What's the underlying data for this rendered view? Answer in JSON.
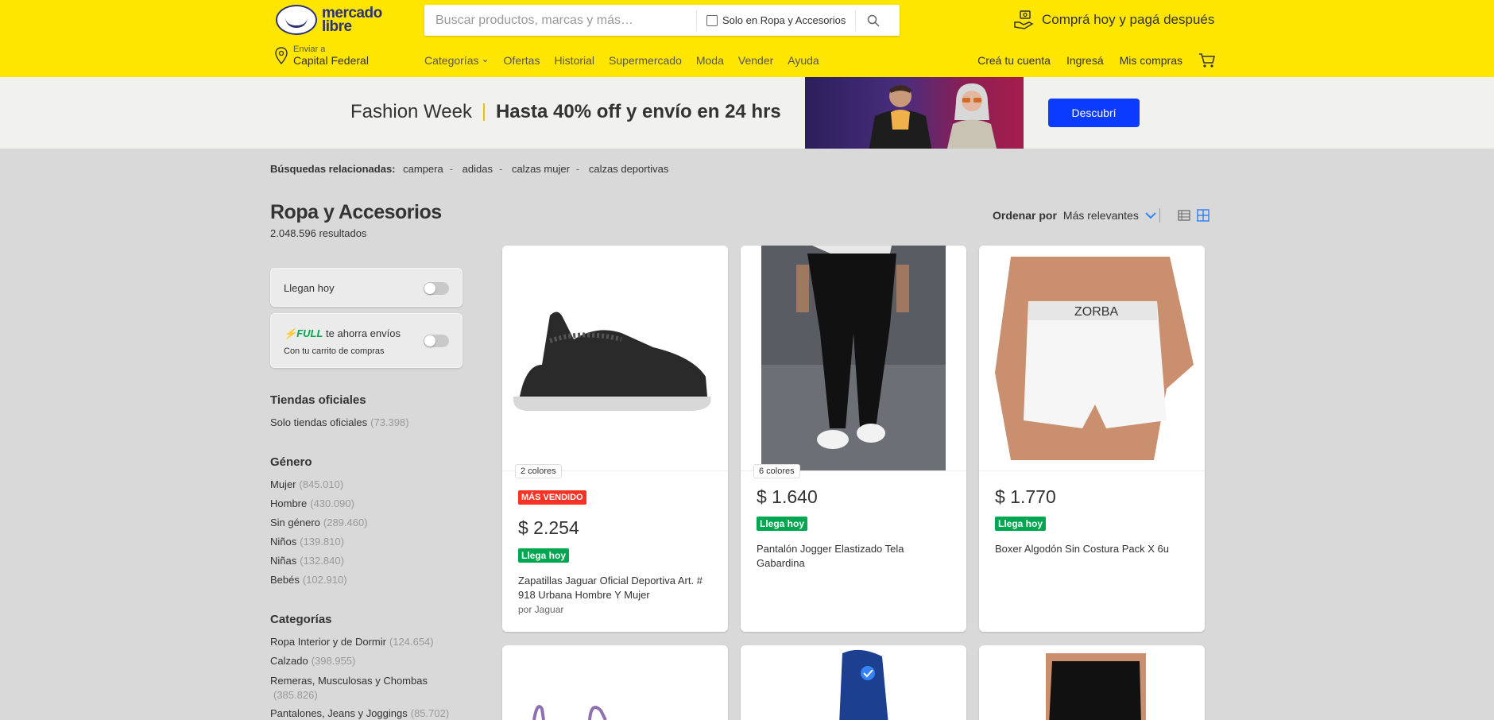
{
  "header": {
    "logo_text": "mercado libre",
    "search_placeholder": "Buscar productos, marcas y más…",
    "search_filter_label": "Solo en Ropa y Accesorios",
    "promo": "Comprá hoy y pagá después",
    "location_small": "Enviar a",
    "location_big": "Capital Federal",
    "nav": [
      "Categorías",
      "Ofertas",
      "Historial",
      "Supermercado",
      "Moda",
      "Vender",
      "Ayuda"
    ],
    "user_nav": [
      "Creá tu cuenta",
      "Ingresá",
      "Mis compras"
    ]
  },
  "banner": {
    "left": "Fashion Week",
    "right": "Hasta 40% off y envío en 24 hrs",
    "button": "Descubrí"
  },
  "related": {
    "label": "Búsquedas relacionadas:",
    "terms": [
      "campera",
      "adidas",
      "calzas mujer",
      "calzas deportivas"
    ]
  },
  "page": {
    "title": "Ropa y Accesorios",
    "results": "2.048.596 resultados"
  },
  "sort": {
    "label": "Ordenar por",
    "value": "Más relevantes"
  },
  "toggles": {
    "llegan_hoy": "Llegan hoy",
    "full_badge": "FULL",
    "full_text": "te ahorra envíos",
    "full_sub": "Con tu carrito de compras"
  },
  "filters": {
    "tiendas": {
      "title": "Tiendas oficiales",
      "items": [
        {
          "label": "Solo tiendas oficiales",
          "count": "(73.398)"
        }
      ]
    },
    "genero": {
      "title": "Género",
      "items": [
        {
          "label": "Mujer",
          "count": "(845.010)"
        },
        {
          "label": "Hombre",
          "count": "(430.090)"
        },
        {
          "label": "Sin género",
          "count": "(289.460)"
        },
        {
          "label": "Niños",
          "count": "(139.810)"
        },
        {
          "label": "Niñas",
          "count": "(132.840)"
        },
        {
          "label": "Bebés",
          "count": "(102.910)"
        }
      ]
    },
    "categorias": {
      "title": "Categorías",
      "items": [
        {
          "label": "Ropa Interior y de Dormir",
          "count": "(124.654)"
        },
        {
          "label": "Calzado",
          "count": "(398.955)"
        },
        {
          "label": "Remeras, Musculosas y Chombas",
          "count": "(385.826)"
        },
        {
          "label": "Pantalones, Jeans y Joggings",
          "count": "(85.702)"
        }
      ]
    }
  },
  "products": [
    {
      "colors": "2 colores",
      "badge": "MÁS VENDIDO",
      "price": "$ 2.254",
      "delivery": "Llega hoy",
      "title": "Zapatillas Jaguar Oficial Deportiva Art. # 918 Urbana Hombre Y Mujer",
      "by": "por Jaguar"
    },
    {
      "colors": "6 colores",
      "price": "$ 1.640",
      "delivery": "Llega hoy",
      "title": "Pantalón Jogger Elastizado Tela Gabardina"
    },
    {
      "price": "$ 1.770",
      "delivery": "Llega hoy",
      "title": "Boxer Algodón Sin Costura Pack X 6u",
      "image_text": "ZORBA"
    }
  ]
}
